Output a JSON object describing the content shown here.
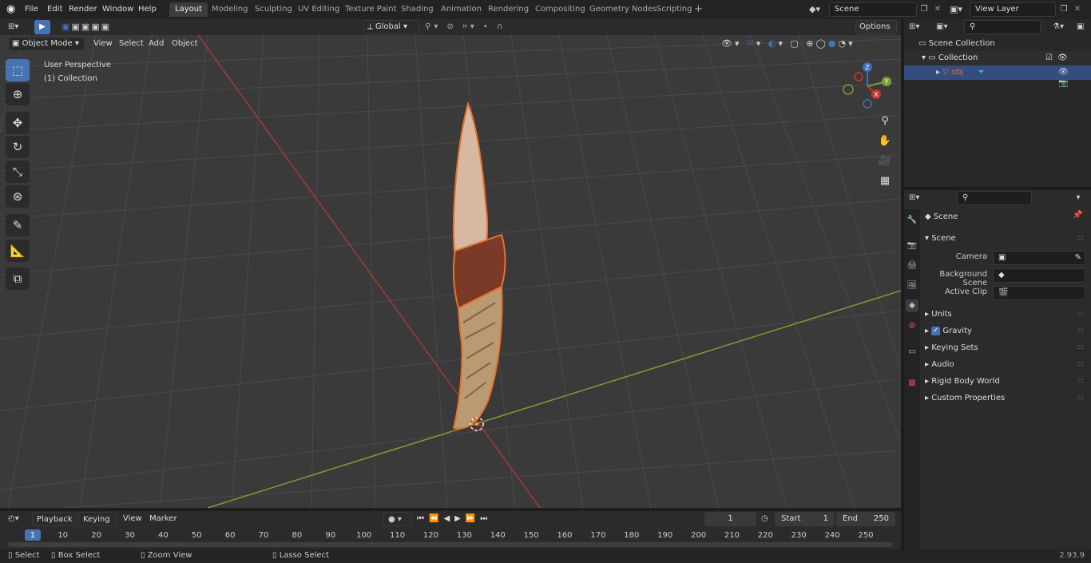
{
  "topbar": {
    "menus": [
      "File",
      "Edit",
      "Render",
      "Window",
      "Help"
    ],
    "workspaces": [
      "Layout",
      "Modeling",
      "Sculpting",
      "UV Editing",
      "Texture Paint",
      "Shading",
      "Animation",
      "Rendering",
      "Compositing",
      "Geometry Nodes",
      "Scripting"
    ],
    "active_workspace": "Layout",
    "scene_name": "Scene",
    "view_layer_name": "View Layer"
  },
  "viewport_header": {
    "mode": "Object Mode",
    "menus": [
      "View",
      "Select",
      "Add",
      "Object"
    ],
    "orientation": "Global",
    "options_label": "Options"
  },
  "viewport": {
    "overlay_line1": "User Perspective",
    "overlay_line2": "(1) Collection",
    "gizmo_x": "X",
    "gizmo_y": "Y",
    "gizmo_z": "Z"
  },
  "outliner": {
    "search_placeholder": "",
    "scene_collection": "Scene Collection",
    "collection": "Collection",
    "object": "obj"
  },
  "properties": {
    "search_placeholder": "",
    "context": "Scene",
    "panel_title": "Scene",
    "camera_label": "Camera",
    "bg_scene_label": "Background Scene",
    "active_clip_label": "Active Clip",
    "sections": [
      "Units",
      "Gravity",
      "Keying Sets",
      "Audio",
      "Rigid Body World",
      "Custom Properties"
    ]
  },
  "timeline": {
    "menus": [
      "Playback",
      "Keying",
      "View",
      "Marker"
    ],
    "current_frame": "1",
    "start_label": "Start",
    "start_value": "1",
    "end_label": "End",
    "end_value": "250",
    "ticks": [
      "1",
      "10",
      "20",
      "30",
      "40",
      "50",
      "60",
      "70",
      "80",
      "90",
      "100",
      "110",
      "120",
      "130",
      "140",
      "150",
      "160",
      "170",
      "180",
      "190",
      "200",
      "210",
      "220",
      "230",
      "240",
      "250"
    ]
  },
  "statusbar": {
    "select": "Select",
    "box_select": "Box Select",
    "zoom_view": "Zoom View",
    "lasso_select": "Lasso Select",
    "version": "2.93.9"
  },
  "colors": {
    "accent": "#4772b3",
    "selection_outline": "#e8712c",
    "x_axis": "#a83a3a",
    "y_axis": "#7aa034"
  }
}
